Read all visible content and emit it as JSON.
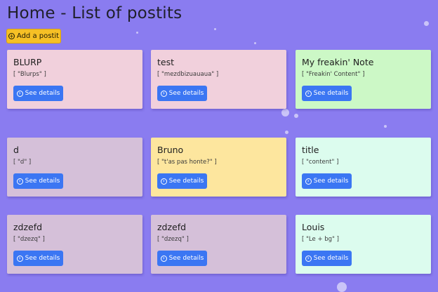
{
  "page": {
    "title": "Home - List of postits"
  },
  "toolbar": {
    "add_label": "Add a postit"
  },
  "cards": [
    {
      "title": "BLURP",
      "content": "[ \"Blurps\" ]",
      "button": "See details",
      "color": "#f1d0dc"
    },
    {
      "title": "test",
      "content": "[ \"mezdbizuauaua\" ]",
      "button": "See details",
      "color": "#f1d0dc"
    },
    {
      "title": "My freakin' Note",
      "content": "[ \"Freakin' Content\" ]",
      "button": "See details",
      "color": "#ccf8c6"
    },
    {
      "title": "d",
      "content": "[ \"d\" ]",
      "button": "See details",
      "color": "#d5c0d9"
    },
    {
      "title": "Bruno",
      "content": "[ \"t'as pas honte?\" ]",
      "button": "See details",
      "color": "#fde69e"
    },
    {
      "title": "title",
      "content": "[ \"content\" ]",
      "button": "See details",
      "color": "#dcfcee"
    },
    {
      "title": "zdzefd",
      "content": "[ \"dzezq\" ]",
      "button": "See details",
      "color": "#d5c0d9"
    },
    {
      "title": "zdzefd",
      "content": "[ \"dzezq\" ]",
      "button": "See details",
      "color": "#d5c0d9"
    },
    {
      "title": "Louis",
      "content": "[ \"Le + bg\" ]",
      "button": "See details",
      "color": "#dcfcee"
    }
  ]
}
